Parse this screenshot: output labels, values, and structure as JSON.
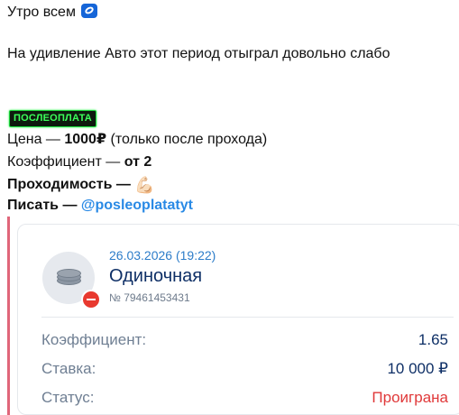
{
  "message": {
    "greeting": "Утро всем",
    "greeting_emoji": "blue-ring-icon",
    "note": "На удивление Авто этот период отыграл довольно слабо",
    "badge": "ПОСЛЕОПЛАТА",
    "price_label": "Цена — ",
    "price_value": "1000₽",
    "price_suffix": " (только после прохода)",
    "coef_label": "Коэффициент — ",
    "coef_value": "от 2",
    "pass_label": "Проходимость — ",
    "pass_emoji": "💪🏻",
    "write_label": "Писать — ",
    "write_link": "@posleoplatatyt"
  },
  "bet_card": {
    "accent_color": "#e0667a",
    "date": "26.03.2026 (19:22)",
    "type": "Одиночная",
    "id": "№ 79461453431",
    "rows": [
      {
        "label": "Коэффициент:",
        "value": "1.65"
      },
      {
        "label": "Ставка:",
        "value": "10 000 ₽"
      },
      {
        "label": "Статус:",
        "value": "Проиграна",
        "status_color": "#e0393a"
      }
    ]
  }
}
